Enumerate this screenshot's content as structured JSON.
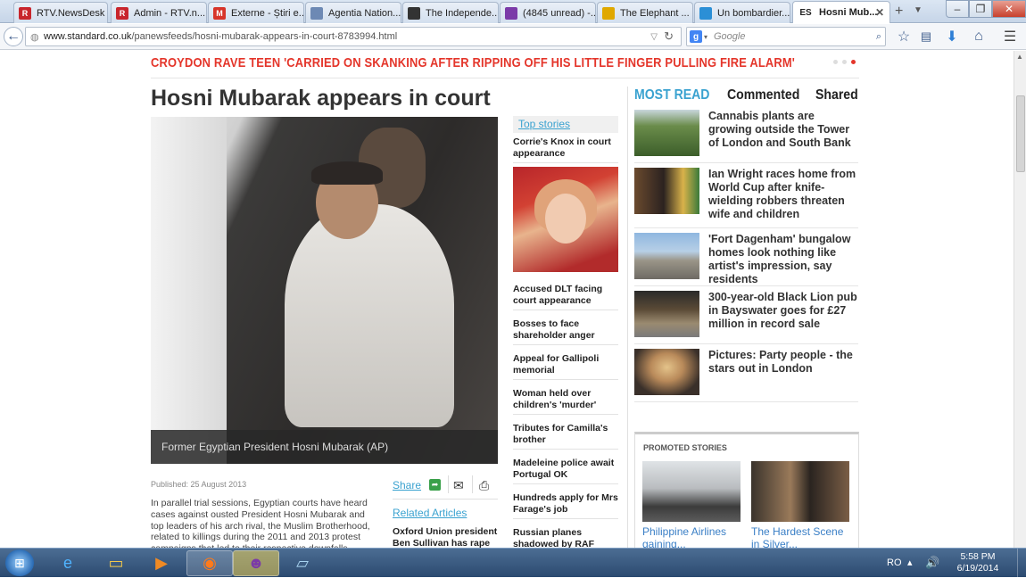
{
  "browser": {
    "tabs": [
      {
        "label": "RTV.NewsDesk",
        "fav": "R",
        "favColor": "#c8252c"
      },
      {
        "label": "Admin - RTV.n...",
        "fav": "R",
        "favColor": "#c8252c"
      },
      {
        "label": "Externe - Știri e...",
        "fav": "M",
        "favColor": "#d7342a"
      },
      {
        "label": "Agentia Nation...",
        "fav": "",
        "favColor": "#6d89b4"
      },
      {
        "label": "The Independe...",
        "fav": "",
        "favColor": "#333333"
      },
      {
        "label": "(4845 unread) -...",
        "fav": "",
        "favColor": "#7b3aa8"
      },
      {
        "label": "The Elephant ...",
        "fav": "",
        "favColor": "#e0a800"
      },
      {
        "label": "Un bombardier...",
        "fav": "",
        "favColor": "#2b8fd6"
      },
      {
        "label": "Hosni Mub...",
        "fav": "ES",
        "favColor": "#ffffff"
      }
    ],
    "url_domain": "www.standard.co.uk",
    "url_path": "/panewsfeeds/hosni-mubarak-appears-in-court-8783994.html",
    "search_placeholder": "Google"
  },
  "page": {
    "ticker": "CROYDON RAVE TEEN 'CARRIED ON SKANKING AFTER RIPPING OFF HIS LITTLE FINGER PULLING FIRE ALARM'",
    "headline": "Hosni Mubarak appears in court",
    "caption": "Former Egyptian President Hosni Mubarak (AP)",
    "published": "Published: 25 August 2013",
    "body": "In parallel trial sessions, Egyptian courts have heard cases against ousted President Hosni Mubarak and top leaders of his arch rival, the Muslim Brotherhood, related to killings during the 2011 and 2013 protest campaigns that led to their respective downfalls.",
    "share_label": "Share",
    "related_heading": "Related Articles",
    "related": [
      "Oxford Union president Ben Sullivan has rape"
    ],
    "top_stories_heading": "Top stories",
    "top_stories": [
      "Corrie's Knox in court appearance",
      "Accused DLT facing court appearance",
      "Bosses to face shareholder anger",
      "Appeal for Gallipoli memorial",
      "Woman held over children's 'murder'",
      "Tributes for Camilla's brother",
      "Madeleine police await Portugal OK",
      "Hundreds apply for Mrs Farage's job",
      "Russian planes shadowed by RAF"
    ],
    "most_read_tabs": [
      "MOST READ",
      "Commented",
      "Shared"
    ],
    "most_read": [
      "Cannabis plants are growing outside the Tower of London and South Bank",
      "Ian Wright races home from World Cup after knife-wielding robbers threaten wife and children",
      "'Fort Dagenham' bungalow homes look nothing like artist's impression, say residents",
      "300-year-old Black Lion pub in Bayswater goes for £27 million in record sale",
      "Pictures: Party people - the stars out in London"
    ],
    "promoted_heading": "PROMOTED STORIES",
    "promoted": [
      "Philippine Airlines gaining...",
      "The Hardest Scene in Silver..."
    ]
  },
  "taskbar": {
    "language": "RO",
    "time": "5:58 PM",
    "date": "6/19/2014"
  },
  "colors": {
    "accent": "#3aa2d0",
    "ticker": "#e4352a"
  }
}
